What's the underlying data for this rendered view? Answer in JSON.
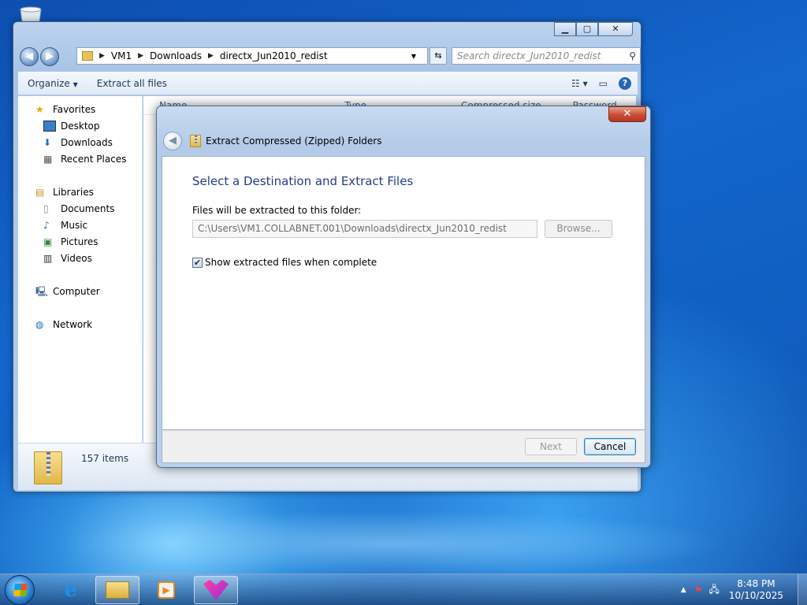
{
  "explorer": {
    "breadcrumb": [
      "VM1",
      "directx_Jun2010_redist"
    ],
    "breadcrumb_mid": "Downloads",
    "search_placeholder": "Search directx_Jun2010_redist",
    "toolbar": {
      "organize": "Organize",
      "extract_all": "Extract all files"
    },
    "nav": {
      "favorites": "Favorites",
      "desktop": "Desktop",
      "downloads": "Downloads",
      "recent_places": "Recent Places",
      "libraries": "Libraries",
      "documents": "Documents",
      "music": "Music",
      "pictures": "Pictures",
      "videos": "Videos",
      "computer": "Computer",
      "network": "Network"
    },
    "columns": {
      "name": "Name",
      "type": "Type",
      "compressed_size": "Compressed size",
      "password": "Password"
    },
    "status": "157 items"
  },
  "dialog": {
    "title": "Extract Compressed (Zipped) Folders",
    "heading": "Select a Destination and Extract Files",
    "folder_label": "Files will be extracted to this folder:",
    "path": "C:\\Users\\VM1.COLLABNET.001\\Downloads\\directx_Jun2010_redist",
    "browse": "Browse...",
    "checkbox_label": "Show extracted files when complete",
    "checkbox_checked": true,
    "next": "Next",
    "cancel": "Cancel"
  },
  "taskbar": {
    "time": "8:48 PM",
    "date": "10/10/2025"
  }
}
